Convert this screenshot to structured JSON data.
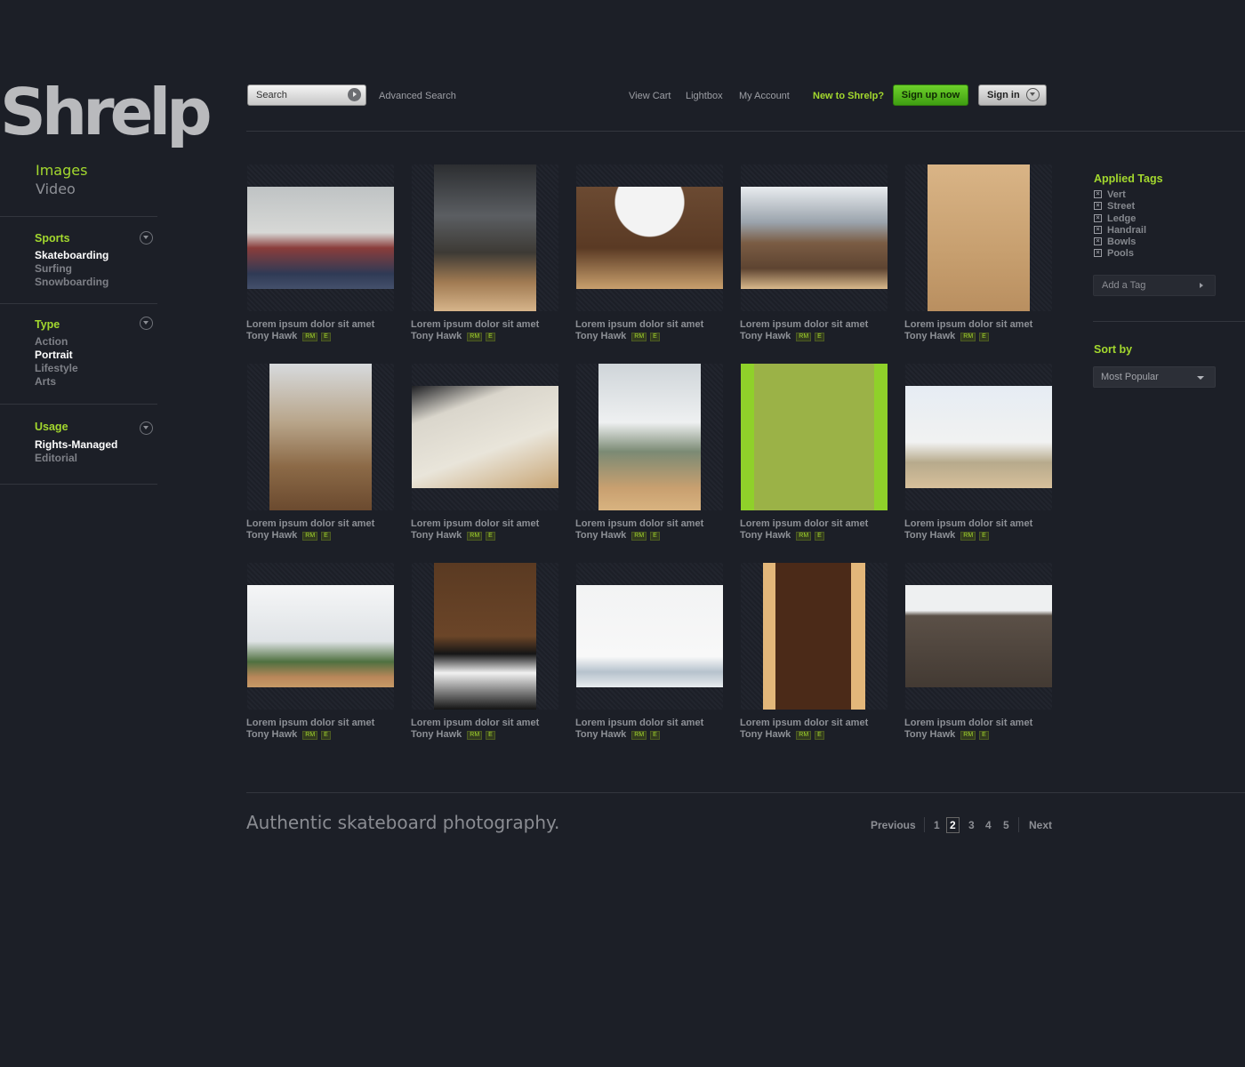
{
  "brand": {
    "logo_text": "Shrelp"
  },
  "media_nav": [
    {
      "label": "Images",
      "active": true
    },
    {
      "label": "Video",
      "active": false
    }
  ],
  "filters": [
    {
      "title": "Sports",
      "items": [
        {
          "label": "Skateboarding",
          "selected": true
        },
        {
          "label": "Surfing",
          "selected": false
        },
        {
          "label": "Snowboarding",
          "selected": false
        }
      ]
    },
    {
      "title": "Type",
      "items": [
        {
          "label": "Action",
          "selected": false
        },
        {
          "label": "Portrait",
          "selected": true
        },
        {
          "label": "Lifestyle",
          "selected": false
        },
        {
          "label": "Arts",
          "selected": false
        }
      ]
    },
    {
      "title": "Usage",
      "items": [
        {
          "label": "Rights-Managed",
          "selected": true
        },
        {
          "label": "Editorial",
          "selected": false
        }
      ]
    }
  ],
  "header": {
    "search_label": "Search",
    "advanced_search": "Advanced Search",
    "links": [
      "View Cart",
      "Lightbox",
      "My Account"
    ],
    "new_prompt": "New to Shrelp?",
    "signup_label": "Sign up now",
    "signin_label": "Sign in"
  },
  "grid": {
    "items": [
      {
        "title": "Lorem ipsum dolor sit amet",
        "author": "Tony Hawk",
        "badges": [
          "RM",
          "E"
        ],
        "scene": "group portrait"
      },
      {
        "title": "Lorem ipsum dolor sit amet",
        "author": "Tony Hawk",
        "badges": [
          "RM",
          "E"
        ],
        "scene": "stormy sky jump"
      },
      {
        "title": "Lorem ipsum dolor sit amet",
        "author": "Tony Hawk",
        "badges": [
          "RM",
          "E"
        ],
        "scene": "halfpipe trick"
      },
      {
        "title": "Lorem ipsum dolor sit amet",
        "author": "Tony Hawk",
        "badges": [
          "RM",
          "E"
        ],
        "scene": "bmx air"
      },
      {
        "title": "Lorem ipsum dolor sit amet",
        "author": "Tony Hawk",
        "badges": [
          "RM",
          "E"
        ],
        "scene": "vert ramp"
      },
      {
        "title": "Lorem ipsum dolor sit amet",
        "author": "Tony Hawk",
        "badges": [
          "RM",
          "E"
        ],
        "scene": "coping grind"
      },
      {
        "title": "Lorem ipsum dolor sit amet",
        "author": "Tony Hawk",
        "badges": [
          "RM",
          "E"
        ],
        "scene": "ramp carve"
      },
      {
        "title": "Lorem ipsum dolor sit amet",
        "author": "Tony Hawk",
        "badges": [
          "RM",
          "E"
        ],
        "scene": "sky air"
      },
      {
        "title": "Lorem ipsum dolor sit amet",
        "author": "Tony Hawk",
        "badges": [
          "RM",
          "E"
        ],
        "scene": "green tinted air"
      },
      {
        "title": "Lorem ipsum dolor sit amet",
        "author": "Tony Hawk",
        "badges": [
          "RM",
          "E"
        ],
        "scene": "tent ramp air"
      },
      {
        "title": "Lorem ipsum dolor sit amet",
        "author": "Tony Hawk",
        "badges": [
          "RM",
          "E"
        ],
        "scene": "city skyline air"
      },
      {
        "title": "Lorem ipsum dolor sit amet",
        "author": "Tony Hawk",
        "badges": [
          "RM",
          "E"
        ],
        "scene": "wall drop"
      },
      {
        "title": "Lorem ipsum dolor sit amet",
        "author": "Tony Hawk",
        "badges": [
          "RM",
          "E"
        ],
        "scene": "bmx flip"
      },
      {
        "title": "Lorem ipsum dolor sit amet",
        "author": "Tony Hawk",
        "badges": [
          "RM",
          "E"
        ],
        "scene": "mega ramp"
      },
      {
        "title": "Lorem ipsum dolor sit amet",
        "author": "Tony Hawk",
        "badges": [
          "RM",
          "E"
        ],
        "scene": "street ledge"
      }
    ]
  },
  "applied_tags": {
    "title": "Applied Tags",
    "items": [
      "Vert",
      "Street",
      "Ledge",
      "Handrail",
      "Bowls",
      "Pools"
    ],
    "add_label": "Add a Tag"
  },
  "sort": {
    "title": "Sort by",
    "value": "Most Popular"
  },
  "footer": {
    "tagline": "Authentic skateboard photography.",
    "pagination": {
      "previous": "Previous",
      "pages": [
        "1",
        "2",
        "3",
        "4",
        "5"
      ],
      "current": "2",
      "next": "Next"
    }
  }
}
